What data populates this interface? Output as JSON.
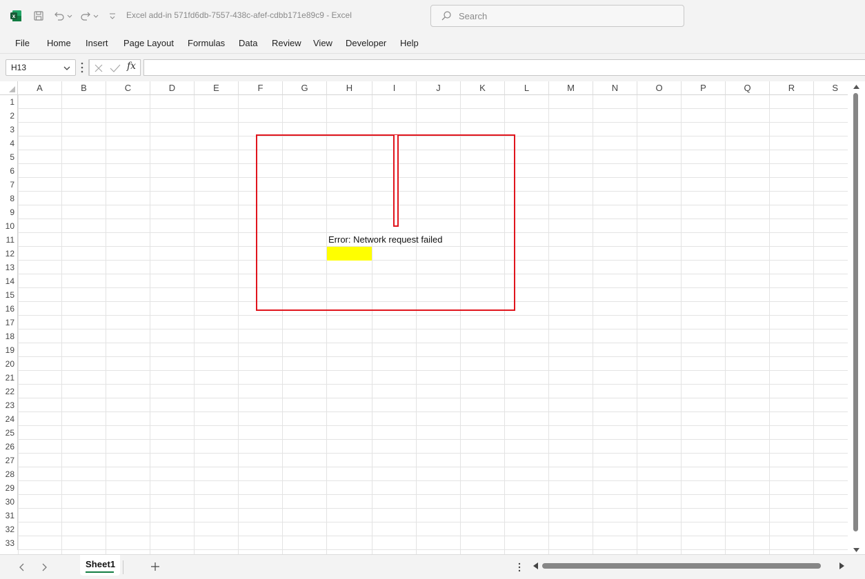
{
  "window": {
    "title": "Excel add-in 571fd6db-7557-438c-afef-cdbb171e89c9  -  Excel",
    "app_icon": "excel-logo",
    "quick_access": [
      "save-icon",
      "undo-icon",
      "redo-icon",
      "customize-icon"
    ]
  },
  "search": {
    "placeholder": "Search"
  },
  "menu": {
    "items": [
      "File",
      "Home",
      "Insert",
      "Page Layout",
      "Formulas",
      "Data",
      "Review",
      "View",
      "Developer",
      "Help"
    ]
  },
  "formula_bar": {
    "name_box": "H13",
    "formula": "",
    "fx_label": "fx"
  },
  "grid": {
    "columns": [
      "A",
      "B",
      "C",
      "D",
      "E",
      "F",
      "G",
      "H",
      "I",
      "J",
      "K",
      "L",
      "M",
      "N",
      "O",
      "P",
      "Q",
      "R",
      "S"
    ],
    "rows": [
      "1",
      "2",
      "3",
      "4",
      "5",
      "6",
      "7",
      "8",
      "9",
      "10",
      "11",
      "12",
      "13",
      "14",
      "15",
      "16",
      "17",
      "18",
      "19",
      "20",
      "21",
      "22",
      "23",
      "24",
      "25",
      "26",
      "27",
      "28",
      "29",
      "30",
      "31",
      "32",
      "33"
    ],
    "active_cell": "H13"
  },
  "addin": {
    "error_message": "Error: Network request failed",
    "frame_color": "#e0141c",
    "highlight_color": "#ffff00"
  },
  "sheets": {
    "tabs": [
      "Sheet1"
    ],
    "active": "Sheet1",
    "accent": "#107c41"
  }
}
